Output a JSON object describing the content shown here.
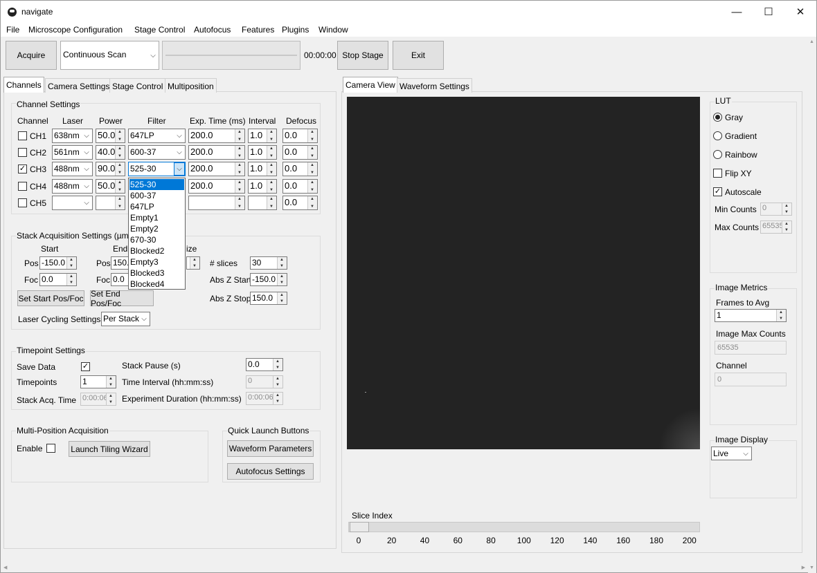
{
  "window": {
    "title": "navigate",
    "minimize": "—",
    "maximize": "☐",
    "close": "✕"
  },
  "menu": [
    "File",
    "Microscope Configuration",
    "Stage Control",
    "Autofocus",
    "Features",
    "Plugins",
    "Window"
  ],
  "toolbar": {
    "acquire": "Acquire",
    "mode": "Continuous Scan",
    "timer": "00:00:00",
    "progress": 0,
    "stop_stage": "Stop Stage",
    "exit": "Exit"
  },
  "left_tabs": [
    "Channels",
    "Camera Settings",
    "Stage Control",
    "Multiposition"
  ],
  "channel_settings": {
    "title": "Channel Settings",
    "headers": [
      "Channel",
      "Laser",
      "Power",
      "Filter",
      "Exp. Time (ms)",
      "Interval",
      "Defocus"
    ],
    "rows": [
      {
        "name": "CH1",
        "checked": false,
        "laser": "638nm",
        "power": "50.0",
        "filter": "647LP",
        "exp": "200.0",
        "interval": "1.0",
        "defocus": "0.0"
      },
      {
        "name": "CH2",
        "checked": false,
        "laser": "561nm",
        "power": "40.0",
        "filter": "600-37",
        "exp": "200.0",
        "interval": "1.0",
        "defocus": "0.0"
      },
      {
        "name": "CH3",
        "checked": true,
        "laser": "488nm",
        "power": "90.0",
        "filter": "525-30",
        "exp": "200.0",
        "interval": "1.0",
        "defocus": "0.0"
      },
      {
        "name": "CH4",
        "checked": false,
        "laser": "488nm",
        "power": "50.0",
        "filter": "",
        "exp": "200.0",
        "interval": "1.0",
        "defocus": "0.0"
      },
      {
        "name": "CH5",
        "checked": false,
        "laser": "",
        "power": "",
        "filter": "",
        "exp": "",
        "interval": "",
        "defocus": "0.0"
      }
    ],
    "filter_options": [
      "525-30",
      "600-37",
      "647LP",
      "Empty1",
      "Empty2",
      "670-30",
      "Blocked2",
      "Empty3",
      "Blocked3",
      "Blocked4"
    ],
    "filter_selected": "525-30"
  },
  "stack": {
    "title": "Stack Acquisition Settings (µm)",
    "start_label": "Start",
    "end_label": "End",
    "size_label": "ize",
    "pos_label": "Pos",
    "foc_label": "Foc",
    "start_pos": "-150.0",
    "start_foc": "0.0",
    "end_pos": "150.0",
    "end_foc": "0.0",
    "slices_label": "# slices",
    "slices": "30",
    "abs_start_label": "Abs Z Start",
    "abs_start": "-150.0",
    "abs_stop_label": "Abs Z Stop",
    "abs_stop": "150.0",
    "set_start": "Set Start Pos/Foc",
    "set_end": "Set End Pos/Foc",
    "cycling_label": "Laser Cycling Settings",
    "cycling": "Per Stack"
  },
  "timepoint": {
    "title": "Timepoint Settings",
    "save_label": "Save Data",
    "save_checked": true,
    "timepoints_label": "Timepoints",
    "timepoints": "1",
    "stack_acq_label": "Stack Acq. Time",
    "stack_acq": "0:00:06",
    "pause_label": "Stack Pause (s)",
    "pause": "0.0",
    "interval_label": "Time Interval (hh:mm:ss)",
    "interval": "0",
    "duration_label": "Experiment Duration (hh:mm:ss)",
    "duration": "0:00:06"
  },
  "multipos": {
    "title": "Multi-Position Acquisition",
    "enable_label": "Enable",
    "enable_checked": false,
    "tiling": "Launch Tiling Wizard"
  },
  "quick": {
    "title": "Quick Launch Buttons",
    "waveform": "Waveform Parameters",
    "autofocus": "Autofocus Settings"
  },
  "right_tabs": [
    "Camera View",
    "Waveform Settings"
  ],
  "lut": {
    "title": "LUT",
    "options": [
      "Gray",
      "Gradient",
      "Rainbow"
    ],
    "selected": "Gray",
    "flip_label": "Flip XY",
    "flip": false,
    "autoscale_label": "Autoscale",
    "autoscale": true,
    "min_label": "Min Counts",
    "min": "0",
    "max_label": "Max Counts",
    "max": "65535"
  },
  "metrics": {
    "title": "Image Metrics",
    "frames_label": "Frames to Avg",
    "frames": "1",
    "max_label": "Image Max Counts",
    "max": "65535",
    "channel_label": "Channel",
    "channel": "0"
  },
  "display": {
    "title": "Image Display",
    "mode": "Live"
  },
  "slice": {
    "label": "Slice Index",
    "value": 0,
    "min": 0,
    "max": 200,
    "ticks": [
      "0",
      "20",
      "40",
      "60",
      "80",
      "100",
      "120",
      "140",
      "160",
      "180",
      "200"
    ]
  }
}
